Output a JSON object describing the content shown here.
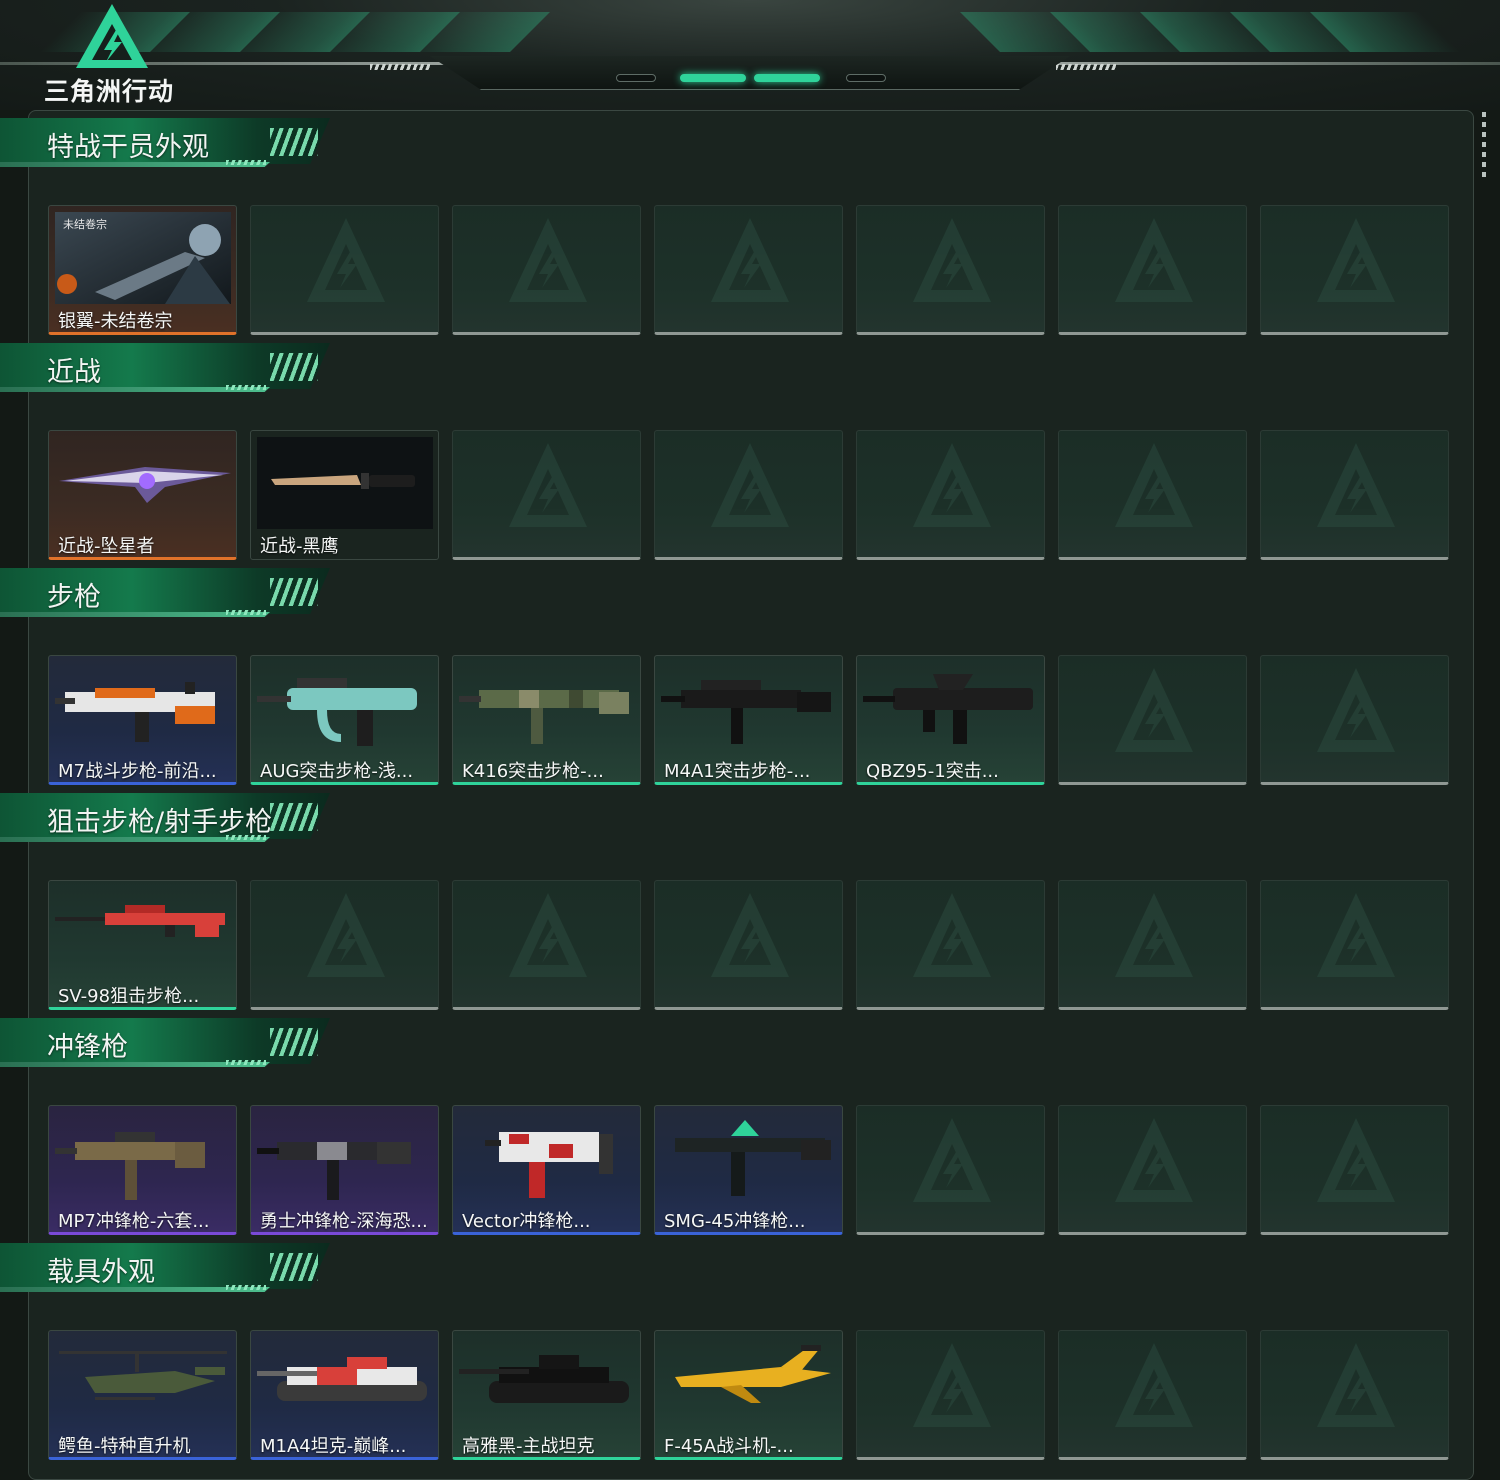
{
  "header": {
    "logo_text": "三角洲行动",
    "nav_indicators": 4,
    "active_indicators": [
      1,
      2
    ]
  },
  "colors": {
    "accent": "#2fd39a",
    "rarity_orange": "#e0722a",
    "rarity_blue": "#3a63d8",
    "rarity_purple": "#7a4ad8",
    "rarity_green": "#2fd39a",
    "empty_slot": "#8f9893"
  },
  "slots_per_row": 7,
  "sections": [
    {
      "title": "特战干员外观",
      "items": [
        {
          "name": "银翼-未结卷宗",
          "rarity": "orange",
          "icon": "operator-portrait",
          "thumb_label": "未结卷宗"
        }
      ]
    },
    {
      "title": "近战",
      "items": [
        {
          "name": "近战-坠星者",
          "rarity": "orange",
          "icon": "blade"
        },
        {
          "name": "近战-黑鹰",
          "rarity": "none",
          "icon": "knife"
        }
      ]
    },
    {
      "title": "步枪",
      "items": [
        {
          "name": "M7战斗步枪-前沿...",
          "rarity": "blue",
          "icon": "rifle-orange"
        },
        {
          "name": "AUG突击步枪-浅...",
          "rarity": "green",
          "icon": "rifle-teal"
        },
        {
          "name": "K416突击步枪-...",
          "rarity": "green",
          "icon": "rifle-camo"
        },
        {
          "name": "M4A1突击步枪-...",
          "rarity": "green",
          "icon": "rifle-black"
        },
        {
          "name": "QBZ95-1突击...",
          "rarity": "green",
          "icon": "rifle-bullpup"
        }
      ]
    },
    {
      "title": "狙击步枪/射手步枪",
      "items": [
        {
          "name": "SV-98狙击步枪...",
          "rarity": "green",
          "icon": "sniper-red"
        }
      ]
    },
    {
      "title": "冲锋枪",
      "items": [
        {
          "name": "MP7冲锋枪-六套...",
          "rarity": "purple",
          "icon": "smg-tan"
        },
        {
          "name": "勇士冲锋枪-深海恐...",
          "rarity": "purple",
          "icon": "smg-dark"
        },
        {
          "name": "Vector冲锋枪...",
          "rarity": "blue",
          "icon": "smg-redcamo"
        },
        {
          "name": "SMG-45冲锋枪...",
          "rarity": "blue",
          "icon": "smg-green"
        }
      ]
    },
    {
      "title": "载具外观",
      "items": [
        {
          "name": "鳄鱼-特种直升机",
          "rarity": "blue",
          "icon": "helicopter"
        },
        {
          "name": "M1A4坦克-巅峰...",
          "rarity": "blue",
          "icon": "tank-red"
        },
        {
          "name": "高雅黑-主战坦克",
          "rarity": "green",
          "icon": "tank-black"
        },
        {
          "name": "F-45A战斗机-...",
          "rarity": "green",
          "icon": "jet-yellow"
        }
      ]
    }
  ]
}
